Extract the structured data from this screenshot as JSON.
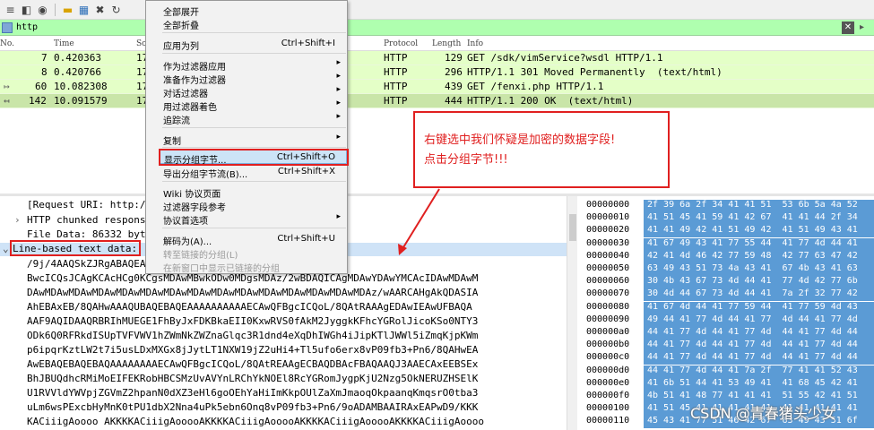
{
  "filter": {
    "value": "http"
  },
  "columns": {
    "no": "No.",
    "time": "Time",
    "source": "So",
    "protocol": "Protocol",
    "length": "Length",
    "info": "Info"
  },
  "packets": [
    {
      "no": "7",
      "time": "0.420363",
      "source": "17",
      "protocol": "HTTP",
      "length": "129",
      "info": "GET /sdk/vimService?wsdl HTTP/1.1"
    },
    {
      "no": "8",
      "time": "0.420766",
      "source": "17",
      "protocol": "HTTP",
      "length": "296",
      "info": "HTTP/1.1 301 Moved Permanently  (text/html)"
    },
    {
      "no": "60",
      "time": "10.082308",
      "source": "17",
      "protocol": "HTTP",
      "length": "439",
      "info": "GET /fenxi.php HTTP/1.1"
    },
    {
      "no": "142",
      "time": "10.091579",
      "source": "17",
      "protocol": "HTTP",
      "length": "444",
      "info": "HTTP/1.1 200 OK  (text/html)"
    }
  ],
  "menu": {
    "expand_all": "全部展开",
    "collapse_all": "全部折叠",
    "apply_as_column": "应用为列",
    "apply_as_column_sc": "Ctrl+Shift+I",
    "apply_as_filter": "作为过滤器应用",
    "prepare_filter": "准备作为过滤器",
    "conversation_filter": "对话过滤器",
    "colorize": "用过滤器着色",
    "follow_stream": "追踪流",
    "copy": "复制",
    "show_packet_bytes": "显示分组字节...",
    "show_packet_bytes_sc": "Ctrl+Shift+O",
    "export_packet_bytes": "导出分组字节流(B)...",
    "export_packet_bytes_sc": "Ctrl+Shift+X",
    "wiki": "Wiki 协议页面",
    "filter_field_ref": "过滤器字段参考",
    "protocol_prefs": "协议首选项",
    "decode_as": "解码为(A)...",
    "decode_as_sc": "Ctrl+Shift+U",
    "goto_linked": "转至链接的分组(L)",
    "show_linked_new_window": "在新窗口中显示已链接的分组"
  },
  "detail": {
    "request_uri": "[Request URI: http:/",
    "chunked": "HTTP chunked respons",
    "file_data": "File Data: 86332 byt",
    "line_based": "Line-based text data:",
    "lines": [
      "/9j/4AAQSkZJRgABAQEA",
      "BwcICQsJCAgKCAcHCg0KCgsMDAwMBwkODw0MDgsMDAz/2wBDAQICAgMDAwYDAwYMCAcIDAwMDAwM",
      "DAwMDAwMDAwMDAwMDAwMDAwMDAwMDAwMDAwMDAwMDAwMDAwMDAwMDAwMDAz/wAARCAHgAkQDASIA",
      "AhEBAxEB/8QAHwAAAQUBAQEBAQEAAAAAAAAAAECAwQFBgcICQoL/8QAtRAAAgEDAwIEAwUFBAQA",
      "AAF9AQIDAAQRBRIhMUEGE1FhByJxFDKBkaEII0KxwRVS0fAkM2JyggkKFhcYGRolJicoKSo0NTY3",
      "ODk6Q0RFRkdISUpTVFVWV1hZWmNkZWZnaGlqc3R1dnd4eXqDhIWGh4iJipKTlJWWl5iZmqKjpKWm",
      "p6ipqrKztLW2t7i5usLDxMXGx8jJytLT1NXW19jZ2uHi4+Tl5ufo6erx8vP09fb3+Pn6/8QAHwEA",
      "AwEBAQEBAQEBAQAAAAAAAAECAwQFBgcICQoL/8QAtREAAgECBAQDBAcFBAQAAQJ3AAECAxEEBSEx",
      "BhJBUQdhcRMiMoEIFEKRobHBCSMzUvAVYnLRChYkNOEl8RcYGRomJygpKjU2Nzg5OkNERUZHSElK",
      "U1RVVldYWVpjZGVmZ2hpanN0dXZ3eHl6goOEhYaHiImKkpOUlZaXmJmaoqOkpaanqKmqsrO0tba3",
      "uLm6wsPExcbHyMnK0tPU1dbX2Nna4uPk5ebn6Onq8vP09fb3+Pn6/9oADAMBAAIRAxEAPwD9/KKK",
      "KACiiigAoooo AKKKKACiiigAooooAKKKKACiiigAooooAKKKKACiiigAooooAKKKKACiiigAoooo"
    ]
  },
  "hex": {
    "offsets": [
      "00000000",
      "00000010",
      "00000020",
      "00000030",
      "00000040",
      "00000050",
      "00000060",
      "00000070",
      "00000080",
      "00000090",
      "000000a0",
      "000000b0",
      "000000c0",
      "000000d0",
      "000000e0",
      "000000f0",
      "00000100",
      "00000110"
    ],
    "bytes": [
      "2f 39 6a 2f 34 41 41 51  53 6b 5a 4a 52",
      "41 51 45 41 59 41 42 67  41 41 44 2f 34",
      "41 41 49 42 41 51 49 42  41 51 49 43 41",
      "41 67 49 43 41 77 55 44  41 77 4d 44 41",
      "42 41 4d 46 42 77 59 48  42 77 63 47 42",
      "63 49 43 51 73 4a 43 41  67 4b 43 41 63",
      "30 4b 43 67 73 4d 44 41  77 4d 42 77 6b",
      "30 4d 44 67 73 4d 44 41  7a 2f 32 77 42",
      "41 67 4d 44 41 77 59 44  41 77 59 4d 43",
      "49 44 41 77 4d 44 41 77  4d 44 41 77 4d",
      "44 41 77 4d 44 41 77 4d  44 41 77 4d 44",
      "44 41 77 4d 44 41 77 4d  44 41 77 4d 44",
      "44 41 77 4d 44 41 77 4d  44 41 77 4d 44",
      "44 41 77 4d 44 41 7a 2f  77 41 41 52 43",
      "41 6b 51 44 41 53 49 41  41 68 45 42 41",
      "4b 51 41 48 77 41 41 41  51 55 42 41 51",
      "41 51 45 41 41 41 41 41  41 41 41 41 41",
      "45 43 41 77 51 46 42 67  63 49 43 51 6f"
    ]
  },
  "annotation": {
    "line1": "右键选中我们怀疑是加密的数据字段!",
    "line2": "点击分组字节!!!"
  },
  "watermark": "CSDN @青春猪头少女"
}
